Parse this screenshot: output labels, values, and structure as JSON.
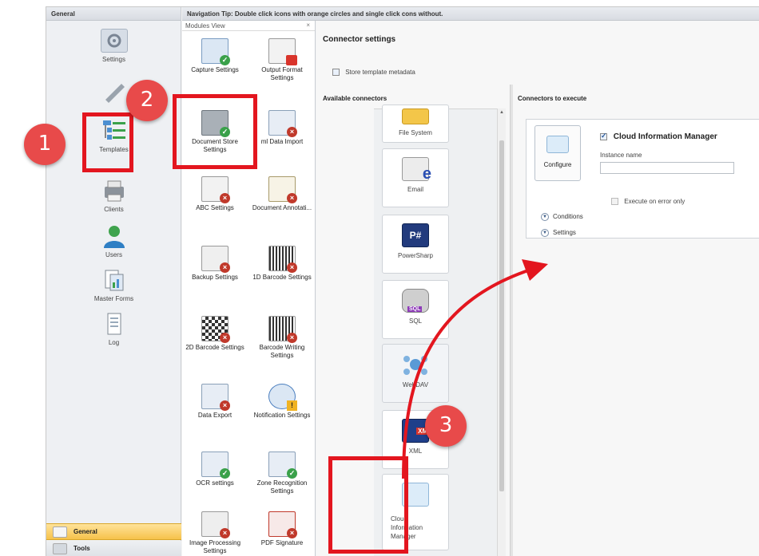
{
  "left_nav": {
    "header": "General",
    "items": [
      {
        "label": "Settings",
        "icon": "gear-icon"
      },
      {
        "label": "",
        "icon": "wrench-icon"
      },
      {
        "label": "Templates",
        "icon": "templates-icon"
      },
      {
        "label": "Clients",
        "icon": "printer-icon"
      },
      {
        "label": "Users",
        "icon": "users-icon"
      },
      {
        "label": "Master Forms",
        "icon": "master-forms-icon"
      },
      {
        "label": "Log",
        "icon": "log-icon"
      }
    ],
    "bottom": [
      {
        "label": "General",
        "icon": "home-icon"
      },
      {
        "label": "Tools",
        "icon": "tools-icon"
      }
    ]
  },
  "tip_bar": "Navigation Tip: Double click icons with orange circles and single click cons without.",
  "modules": {
    "header": "Modules View",
    "close": "×",
    "items": [
      {
        "label": "Capture Settings",
        "status": "ok"
      },
      {
        "label": "Output Format Settings",
        "status": "err"
      },
      {
        "label": "Document Store Settings",
        "status": "ok"
      },
      {
        "label": "ml Data Import",
        "status": "err"
      },
      {
        "label": "ABC Settings",
        "status": "err"
      },
      {
        "label": "Document Annotati...",
        "status": "err"
      },
      {
        "label": "Backup Settings",
        "status": "err"
      },
      {
        "label": "1D Barcode Settings",
        "status": "err"
      },
      {
        "label": "2D Barcode Settings",
        "status": "err"
      },
      {
        "label": "Barcode Writing Settings",
        "status": "err"
      },
      {
        "label": "Data Export",
        "status": "err"
      },
      {
        "label": "Notification Settings",
        "status": "err"
      },
      {
        "label": "OCR settings",
        "status": "ok"
      },
      {
        "label": "Zone Recognition Settings",
        "status": "ok"
      },
      {
        "label": "Image Processing Settings",
        "status": "err"
      },
      {
        "label": "PDF Signature",
        "status": "err"
      }
    ]
  },
  "connector": {
    "title": "Connector settings",
    "store_meta_label": "Store template metadata",
    "available_title": "Available connectors",
    "execute_title": "Connectors to execute",
    "available": [
      {
        "label": "File System",
        "icon": "folder-icon"
      },
      {
        "label": "Email",
        "icon": "email-icon"
      },
      {
        "label": "PowerSharp",
        "icon": "powersharp-icon",
        "glyph": "P#"
      },
      {
        "label": "SQL",
        "icon": "database-icon",
        "glyph": "SQL"
      },
      {
        "label": "WebDAV",
        "icon": "webdav-icon"
      },
      {
        "label": "XML",
        "icon": "xml-icon",
        "glyph": "XML"
      },
      {
        "label": "Cloud Information Manager",
        "icon": "cloud-icon"
      }
    ],
    "execute": {
      "configure_label": "Configure",
      "name": "Cloud Information Manager",
      "instance_label": "Instance name",
      "instance_value": "",
      "error_only_label": "Execute on error only",
      "conditions_label": "Conditions",
      "settings_label": "Settings"
    }
  },
  "callouts": [
    "1",
    "2",
    "3"
  ],
  "colors": {
    "annotation_red": "#e3161f",
    "callout_fill": "#e84a4a",
    "ok_badge": "#3aa14a",
    "err_badge": "#c0392b"
  }
}
